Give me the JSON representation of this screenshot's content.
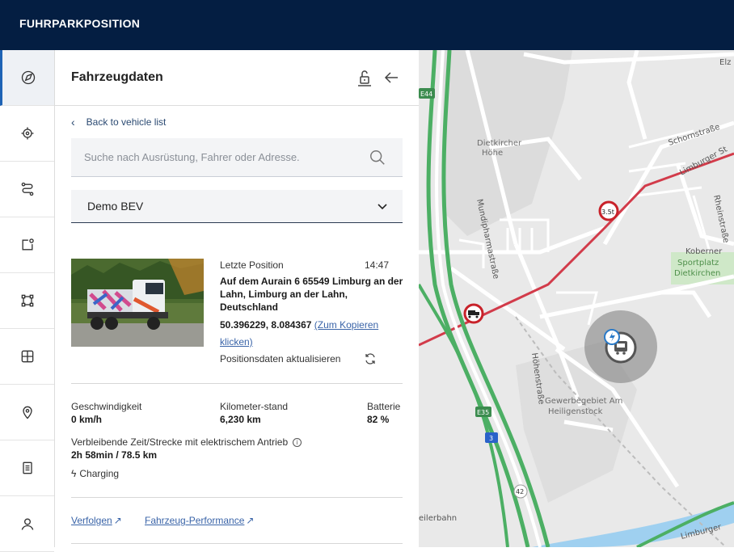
{
  "app": {
    "title": "FUHRPARKPOSITION"
  },
  "colors": {
    "topbar": "#041e42",
    "accent": "#1e63b5",
    "link": "#3a64a8",
    "road_red": "#d23b4a",
    "highway_green": "#4caf64"
  },
  "rail": {
    "items": [
      {
        "icon": "navigation-icon",
        "active": true
      },
      {
        "icon": "target-icon",
        "active": false
      },
      {
        "icon": "route-icon",
        "active": false
      },
      {
        "icon": "notification-box-icon",
        "active": false
      },
      {
        "icon": "geofence-icon",
        "active": false
      },
      {
        "icon": "grid-icon",
        "active": false
      },
      {
        "icon": "location-pin-icon",
        "active": false
      },
      {
        "icon": "document-icon",
        "active": false
      },
      {
        "icon": "user-icon",
        "active": false
      }
    ]
  },
  "panel": {
    "title": "Fahrzeugdaten",
    "back_label": "Back to vehicle list",
    "search_placeholder": "Suche nach Ausrüstung, Fahrer oder Adresse.",
    "selected_vehicle": "Demo BEV",
    "position": {
      "label": "Letzte Position",
      "time": "14:47",
      "address": "Auf dem Aurain 6 65549 Limburg an der Lahn, Limburg an der Lahn, Deutschland",
      "coords": "50.396229, 8.084367",
      "copy_label": "(Zum Kopieren klicken)",
      "refresh_label": "Positionsdaten aktualisieren"
    },
    "stats": {
      "speed_label": "Geschwindigkeit",
      "speed_value": "0 km/h",
      "odometer_label": "Kilometer-stand",
      "odometer_value": "6,230 km",
      "battery_label": "Batterie",
      "battery_value": "82 %"
    },
    "remaining": {
      "label": "Verbleibende Zeit/Strecke mit elektrischem Antrieb",
      "value": "2h 58min / 78.5 km"
    },
    "charging_label": "Charging",
    "links": {
      "follow": "Verfolgen",
      "performance": "Fahrzeug-Performance"
    }
  },
  "map": {
    "labels": {
      "elz": "Elz",
      "e44": "E44",
      "dietkircher_hoehe_1": "Dietkircher",
      "dietkircher_hoehe_2": "Höhe",
      "schornstrasse": "Schornstraße",
      "limburger_st": "Limburger St",
      "mundipharmastrasse": "Mundipharmastraße",
      "rheinstrasse": "Rheinstraße",
      "weight_sign": "3.5t",
      "koberner": "Koberner",
      "sportplatz_1": "Sportplatz",
      "sportplatz_2": "Dietkirchen",
      "hoehenstrasse": "Höhenstraße",
      "gewerbe_1": "Gewerbegebiet Am",
      "gewerbe_2": "Heiligenstock",
      "e35": "E35",
      "route3": "3",
      "route42": "42",
      "eilerbahn": "eilerbahn",
      "limburger_bottom": "Limburger"
    }
  }
}
